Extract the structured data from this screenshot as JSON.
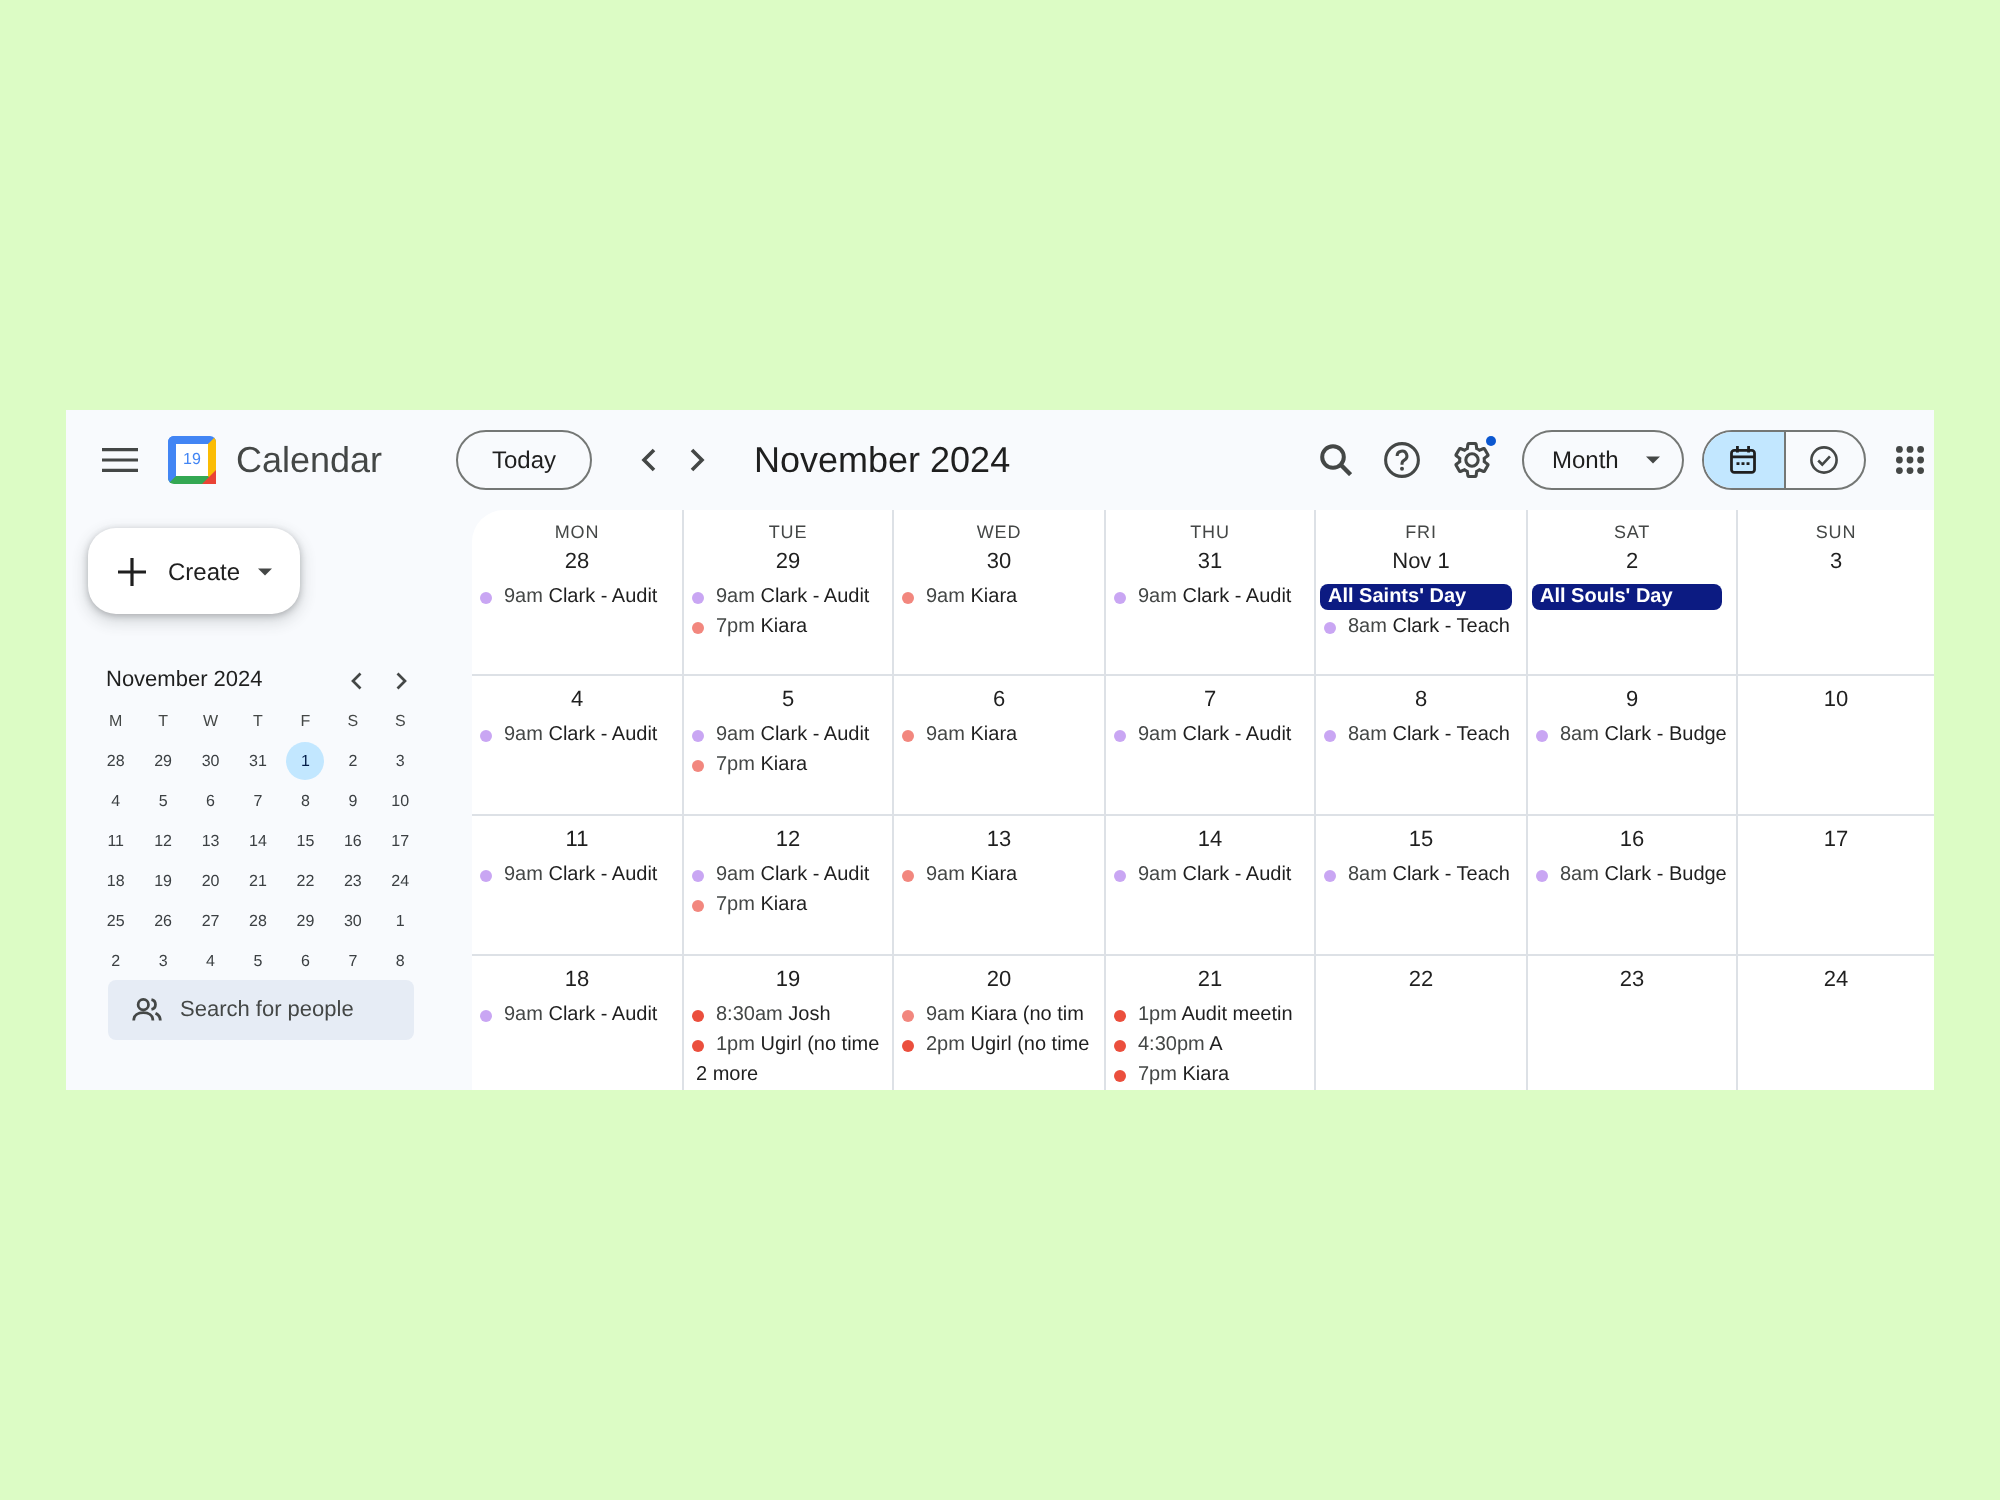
{
  "header": {
    "logo_text": "19",
    "title": "Calendar",
    "today_button": "Today",
    "period": "November 2024",
    "settings_badge": true,
    "view_select": "Month",
    "view_toggle": [
      {
        "kind": "calendar",
        "selected": true
      },
      {
        "kind": "tasks",
        "selected": false
      }
    ]
  },
  "sidebar": {
    "create_button": "Create",
    "mini_calendar": {
      "title": "November 2024",
      "weekdays": [
        "M",
        "T",
        "W",
        "T",
        "F",
        "S",
        "S"
      ],
      "weeks": [
        [
          {
            "day": "28",
            "selected": false
          },
          {
            "day": "29",
            "selected": false
          },
          {
            "day": "30",
            "selected": false
          },
          {
            "day": "31",
            "selected": false
          },
          {
            "day": "1",
            "selected": true
          },
          {
            "day": "2",
            "selected": false
          },
          {
            "day": "3",
            "selected": false
          }
        ],
        [
          {
            "day": "4",
            "selected": false
          },
          {
            "day": "5",
            "selected": false
          },
          {
            "day": "6",
            "selected": false
          },
          {
            "day": "7",
            "selected": false
          },
          {
            "day": "8",
            "selected": false
          },
          {
            "day": "9",
            "selected": false
          },
          {
            "day": "10",
            "selected": false
          }
        ],
        [
          {
            "day": "11",
            "selected": false
          },
          {
            "day": "12",
            "selected": false
          },
          {
            "day": "13",
            "selected": false
          },
          {
            "day": "14",
            "selected": false
          },
          {
            "day": "15",
            "selected": false
          },
          {
            "day": "16",
            "selected": false
          },
          {
            "day": "17",
            "selected": false
          }
        ],
        [
          {
            "day": "18",
            "selected": false
          },
          {
            "day": "19",
            "selected": false
          },
          {
            "day": "20",
            "selected": false
          },
          {
            "day": "21",
            "selected": false
          },
          {
            "day": "22",
            "selected": false
          },
          {
            "day": "23",
            "selected": false
          },
          {
            "day": "24",
            "selected": false
          }
        ],
        [
          {
            "day": "25",
            "selected": false
          },
          {
            "day": "26",
            "selected": false
          },
          {
            "day": "27",
            "selected": false
          },
          {
            "day": "28",
            "selected": false
          },
          {
            "day": "29",
            "selected": false
          },
          {
            "day": "30",
            "selected": false
          },
          {
            "day": "1",
            "selected": false
          }
        ],
        [
          {
            "day": "2",
            "selected": false
          },
          {
            "day": "3",
            "selected": false
          },
          {
            "day": "4",
            "selected": false
          },
          {
            "day": "5",
            "selected": false
          },
          {
            "day": "6",
            "selected": false
          },
          {
            "day": "7",
            "selected": false
          },
          {
            "day": "8",
            "selected": false
          }
        ]
      ]
    },
    "people_search": {
      "placeholder": "Search for people"
    }
  },
  "month_grid": {
    "weekdays": [
      "MON",
      "TUE",
      "WED",
      "THU",
      "FRI",
      "SAT",
      "SUN"
    ],
    "weeks": [
      [
        {
          "date": "28",
          "events": [
            {
              "kind": "timed",
              "time": "9am",
              "title": "Clark - Audit",
              "color": "#c9a6f3"
            }
          ]
        },
        {
          "date": "29",
          "events": [
            {
              "kind": "timed",
              "time": "9am",
              "title": "Clark - Audit",
              "color": "#c9a6f3"
            },
            {
              "kind": "timed",
              "time": "7pm",
              "title": "Kiara",
              "color": "#f2877e"
            }
          ]
        },
        {
          "date": "30",
          "events": [
            {
              "kind": "timed",
              "time": "9am",
              "title": "Kiara",
              "color": "#f2877e"
            }
          ]
        },
        {
          "date": "31",
          "events": [
            {
              "kind": "timed",
              "time": "9am",
              "title": "Clark - Audit",
              "color": "#c9a6f3"
            }
          ]
        },
        {
          "date": "Nov 1",
          "events": [
            {
              "kind": "all_day",
              "title": "All Saints' Day",
              "color": "#0c1b82"
            },
            {
              "kind": "timed",
              "time": "8am",
              "title": "Clark - Teach",
              "color": "#c9a6f3"
            }
          ]
        },
        {
          "date": "2",
          "events": [
            {
              "kind": "all_day",
              "title": "All Souls' Day",
              "color": "#0c1b82"
            }
          ]
        },
        {
          "date": "3"
        }
      ],
      [
        {
          "date": "4",
          "events": [
            {
              "kind": "timed",
              "time": "9am",
              "title": "Clark - Audit",
              "color": "#c9a6f3"
            }
          ]
        },
        {
          "date": "5",
          "events": [
            {
              "kind": "timed",
              "time": "9am",
              "title": "Clark - Audit",
              "color": "#c9a6f3"
            },
            {
              "kind": "timed",
              "time": "7pm",
              "title": "Kiara",
              "color": "#f2877e"
            }
          ]
        },
        {
          "date": "6",
          "events": [
            {
              "kind": "timed",
              "time": "9am",
              "title": "Kiara",
              "color": "#f2877e"
            }
          ]
        },
        {
          "date": "7",
          "events": [
            {
              "kind": "timed",
              "time": "9am",
              "title": "Clark - Audit",
              "color": "#c9a6f3"
            }
          ]
        },
        {
          "date": "8",
          "events": [
            {
              "kind": "timed",
              "time": "8am",
              "title": "Clark - Teach",
              "color": "#c9a6f3"
            }
          ]
        },
        {
          "date": "9",
          "events": [
            {
              "kind": "timed",
              "time": "8am",
              "title": "Clark - Budge",
              "color": "#c9a6f3"
            }
          ]
        },
        {
          "date": "10"
        }
      ],
      [
        {
          "date": "11",
          "events": [
            {
              "kind": "timed",
              "time": "9am",
              "title": "Clark - Audit",
              "color": "#c9a6f3"
            }
          ]
        },
        {
          "date": "12",
          "events": [
            {
              "kind": "timed",
              "time": "9am",
              "title": "Clark - Audit",
              "color": "#c9a6f3"
            },
            {
              "kind": "timed",
              "time": "7pm",
              "title": "Kiara",
              "color": "#f2877e"
            }
          ]
        },
        {
          "date": "13",
          "events": [
            {
              "kind": "timed",
              "time": "9am",
              "title": "Kiara",
              "color": "#f2877e"
            }
          ]
        },
        {
          "date": "14",
          "events": [
            {
              "kind": "timed",
              "time": "9am",
              "title": "Clark - Audit",
              "color": "#c9a6f3"
            }
          ]
        },
        {
          "date": "15",
          "events": [
            {
              "kind": "timed",
              "time": "8am",
              "title": "Clark - Teach",
              "color": "#c9a6f3"
            }
          ]
        },
        {
          "date": "16",
          "events": [
            {
              "kind": "timed",
              "time": "8am",
              "title": "Clark - Budge",
              "color": "#c9a6f3"
            }
          ]
        },
        {
          "date": "17"
        }
      ],
      [
        {
          "date": "18",
          "events": [
            {
              "kind": "timed",
              "time": "9am",
              "title": "Clark - Audit",
              "color": "#c9a6f3"
            }
          ]
        },
        {
          "date": "19",
          "events": [
            {
              "kind": "timed",
              "time": "8:30am",
              "title": "Josh",
              "color": "#eb4f3d"
            },
            {
              "kind": "timed",
              "time": "1pm",
              "title": "Ugirl (no time",
              "color": "#eb4f3d"
            }
          ],
          "more": "2 more"
        },
        {
          "date": "20",
          "events": [
            {
              "kind": "timed",
              "time": "9am",
              "title": "Kiara (no tim",
              "color": "#f2877e"
            },
            {
              "kind": "timed",
              "time": "2pm",
              "title": "Ugirl (no time",
              "color": "#eb4f3d"
            }
          ]
        },
        {
          "date": "21",
          "events": [
            {
              "kind": "timed",
              "time": "1pm",
              "title": "Audit meetin",
              "color": "#eb4f3d"
            },
            {
              "kind": "timed",
              "time": "4:30pm",
              "title": "A",
              "color": "#eb4f3d"
            },
            {
              "kind": "timed",
              "time": "7pm",
              "title": "Kiara",
              "color": "#eb4f3d"
            }
          ]
        },
        {
          "date": "22"
        },
        {
          "date": "23"
        },
        {
          "date": "24"
        }
      ]
    ]
  }
}
